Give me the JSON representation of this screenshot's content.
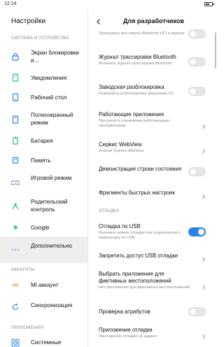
{
  "status_bar": {
    "time": "12:14",
    "battery_level": 0.6
  },
  "left_pane": {
    "title": "Настройки",
    "sections": [
      {
        "header": "СИСТЕМА И УСТРОЙСТВО"
      },
      {
        "header": "АККАУНТЫ"
      },
      {
        "header": "ПРИЛОЖЕНИЯ"
      }
    ],
    "items": [
      {
        "label": "Экран блокировки и…",
        "icon": "lock-icon",
        "color": "#2a84e6"
      },
      {
        "label": "Уведомления",
        "icon": "notification-icon",
        "color": "#2ab8a6"
      },
      {
        "label": "Рабочий стол",
        "icon": "home-icon",
        "color": "#2a84e6"
      },
      {
        "label": "Полноэкранный режим",
        "icon": "fullscreen-icon",
        "color": "#2a84e6"
      },
      {
        "label": "Батарея",
        "icon": "battery-icon",
        "color": "#2ab86a"
      },
      {
        "label": "Память",
        "icon": "memory-icon",
        "color": "#2a84e6"
      },
      {
        "label": "Игровой режим",
        "icon": "game-icon",
        "color": "#9b59d0"
      },
      {
        "label": "Родительский контроль",
        "icon": "parental-icon",
        "color": "#2ab86a"
      },
      {
        "label": "Google",
        "icon": "google-icon",
        "color": "#2ab86a"
      },
      {
        "label": "Дополнительно",
        "icon": "more-icon",
        "color": "#2a84e6"
      },
      {
        "label": "Mi аккаунт",
        "icon": "mi-icon",
        "color": "#f28a1f"
      },
      {
        "label": "Синхронизация",
        "icon": "sync-icon",
        "color": "#2a84e6"
      },
      {
        "label": "Системные",
        "icon": "apps-icon",
        "color": "#2a84e6"
      }
    ]
  },
  "right_pane": {
    "title": "Для разработчиков",
    "section_debug": "ОТЛАДКА",
    "rows": [
      {
        "title": "",
        "subtitle": "Записывать все пакеты Bluetooth HCI в журнал",
        "control": "toggle",
        "on": false
      },
      {
        "title": "Журнал трассировки Bluetooth",
        "subtitle": "Включить журнал трассировки Bluetooth",
        "control": "toggle",
        "on": false
      },
      {
        "title": "Заводская разблокировка",
        "subtitle": "Разрешить разблокировку загрузчика ОС",
        "control": "toggle",
        "on": false
      },
      {
        "title": "Работающие приложения",
        "subtitle": "Просмотр и управление работающими приложениями",
        "control": "chevron"
      },
      {
        "title": "Сервис WebView",
        "subtitle": "Android System WebView",
        "control": "chevron"
      },
      {
        "title": "Демонстрация строки состояния",
        "subtitle": "",
        "control": "toggle",
        "on": false
      },
      {
        "title": "Фрагменты быстрых настроек",
        "subtitle": "",
        "control": "chevron"
      },
      {
        "title": "Отладка по USB",
        "subtitle": "Включить режим отладки при подключении к компьютеру по USB",
        "control": "toggle",
        "on": true
      },
      {
        "title": "Запретить доступ USB отладки",
        "subtitle": "",
        "control": "chevron"
      },
      {
        "title": "Выбрать приложение для фиктивных местоположений",
        "subtitle": "Нет приложения для фиктивных местоположений",
        "control": "chevron"
      },
      {
        "title": "Проверка атрибутов",
        "subtitle": "",
        "control": "toggle",
        "on": false
      },
      {
        "title": "Приложение отладки",
        "subtitle": "Приложение отладки не задано",
        "control": "chevron"
      }
    ]
  },
  "colors": {
    "accent": "#2a84e6",
    "section_text": "#8a8a8a",
    "selected_bg": "#eeeeee"
  }
}
